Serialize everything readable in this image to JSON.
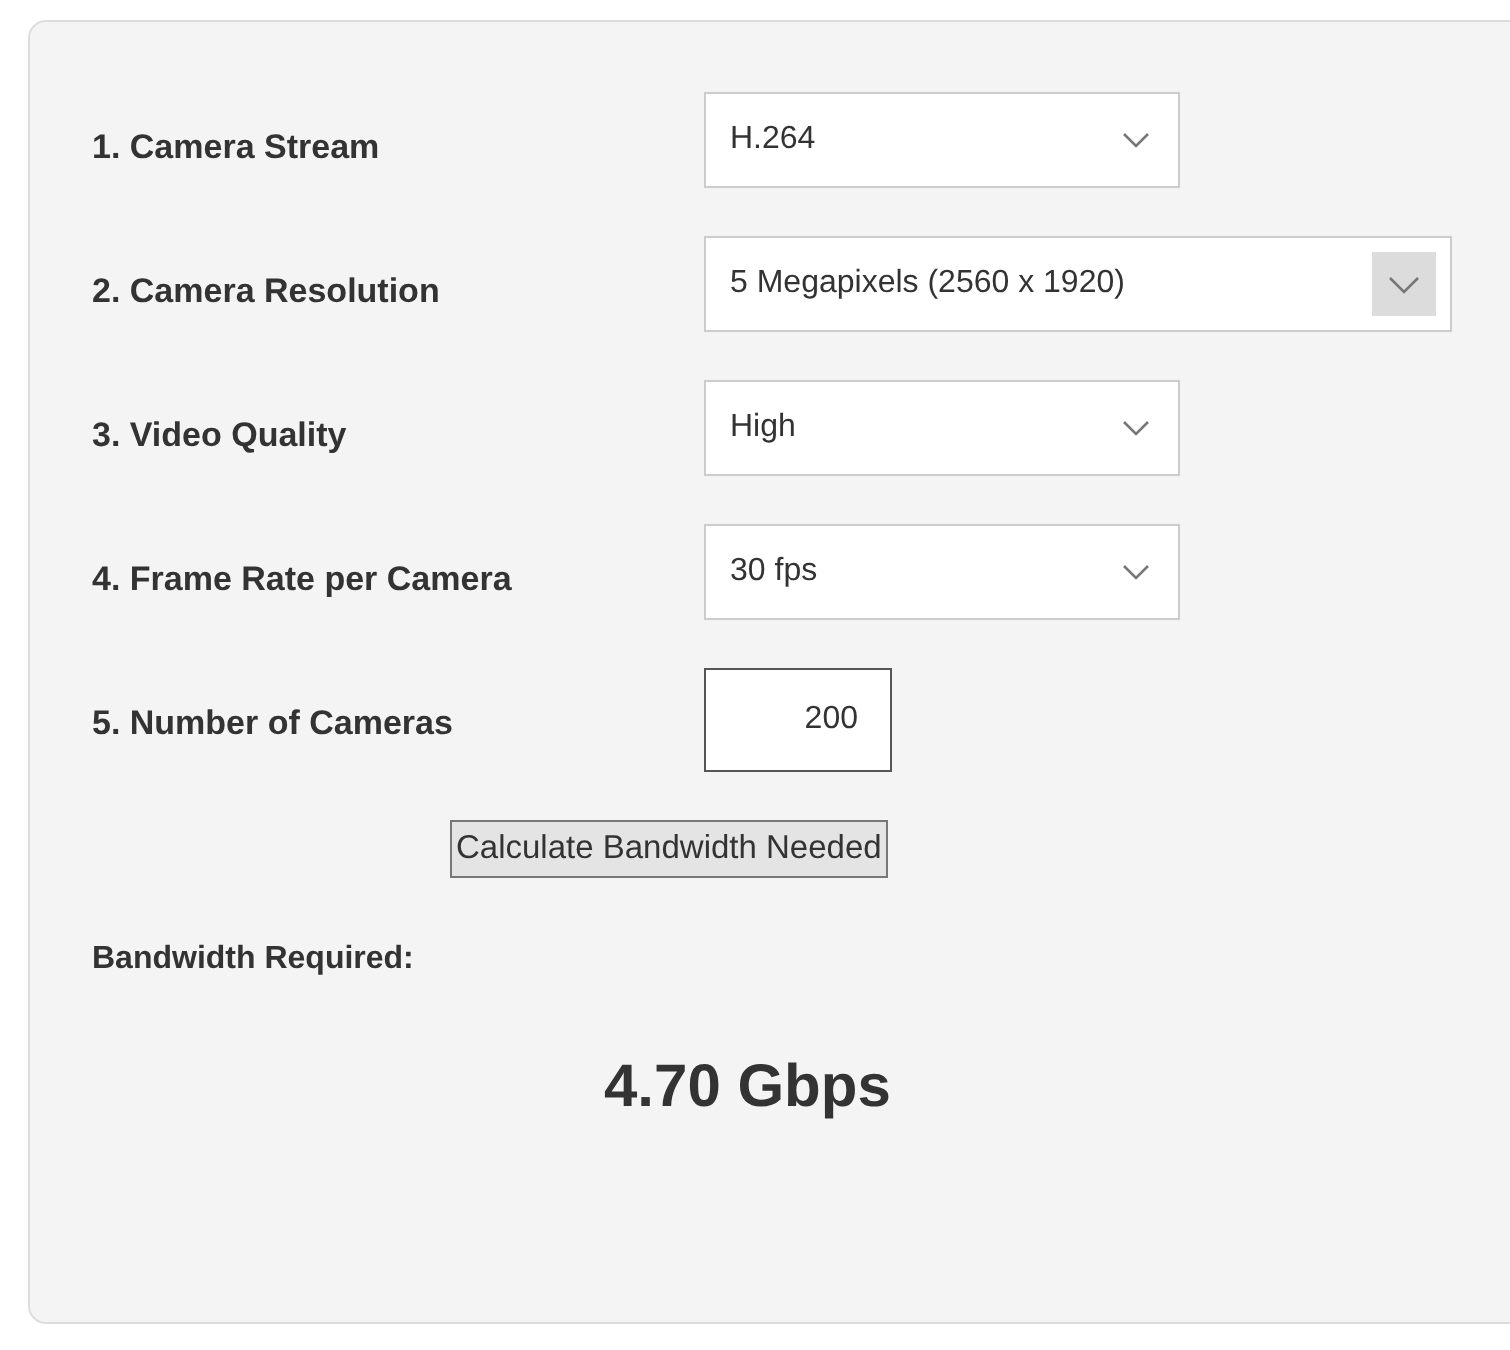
{
  "fields": [
    {
      "label": "1. Camera Stream",
      "kind": "select",
      "value": "H.264"
    },
    {
      "label": "2. Camera Resolution",
      "kind": "select-boxed",
      "value": "5 Megapixels (2560 x 1920)"
    },
    {
      "label": "3. Video Quality",
      "kind": "select",
      "value": "High"
    },
    {
      "label": "4. Frame Rate per Camera",
      "kind": "select",
      "value": "30 fps"
    },
    {
      "label": "5. Number of Cameras",
      "kind": "number",
      "value": "200"
    }
  ],
  "button": "Calculate Bandwidth Needed",
  "result": {
    "label": "Bandwidth Required:",
    "value": "4.70 Gbps"
  }
}
